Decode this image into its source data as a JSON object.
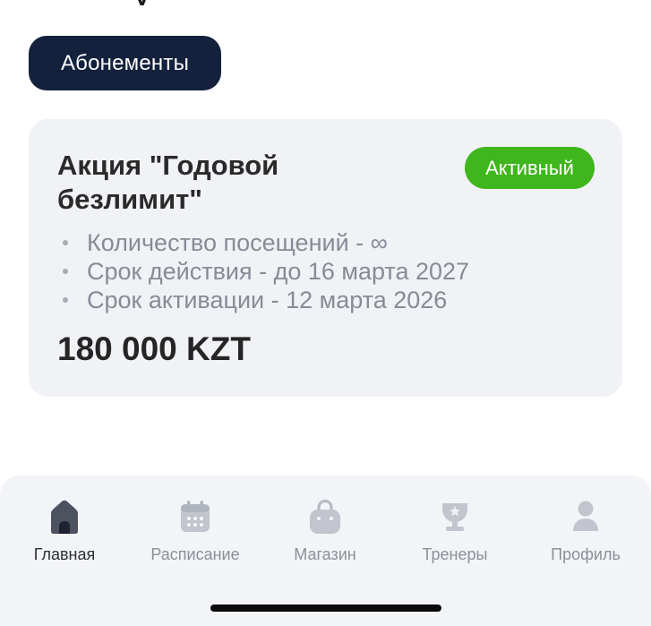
{
  "section_button": {
    "label": "Абонементы"
  },
  "subscription_card": {
    "title": "Акция \"Годовой безлимит\"",
    "status": "Активный",
    "status_color": "#3fb61c",
    "features": [
      "Количество посещений - ∞",
      "Срок действия - до 16 марта 2027",
      "Срок активации - 12 марта 2026"
    ],
    "price": "180 000 KZT"
  },
  "tab_bar": {
    "active_tab": "Главная",
    "tabs": [
      {
        "label": "Главная",
        "icon": "home-icon",
        "active": true
      },
      {
        "label": "Расписание",
        "icon": "calendar-icon",
        "active": false
      },
      {
        "label": "Магазин",
        "icon": "shopping-bag-icon",
        "active": false
      },
      {
        "label": "Тренеры",
        "icon": "trophy-icon",
        "active": false
      },
      {
        "label": "Профиль",
        "icon": "profile-icon",
        "active": false
      }
    ]
  },
  "colors": {
    "pill_bg": "#13213d",
    "card_bg": "#f1f2f6",
    "active_icon": "#4d5260",
    "inactive_icon": "#c2c5cd"
  }
}
